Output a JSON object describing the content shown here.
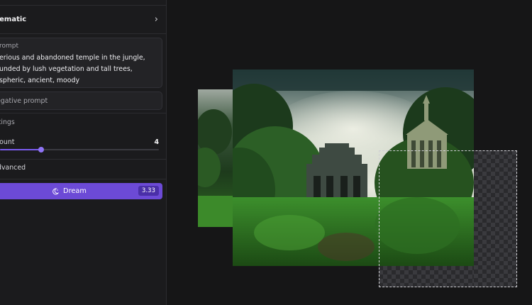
{
  "sidebar": {
    "style": {
      "name": "nematic",
      "chevron_icon": "chevron-right-icon"
    },
    "prompt": {
      "label": "rompt",
      "text": "erious and abandoned temple in the jungle,\nunded by lush vegetation and tall trees,\nspheric, ancient, moody"
    },
    "negative_prompt": {
      "placeholder": "egative prompt",
      "value": ""
    },
    "settings": {
      "title": "ttings",
      "image_count": {
        "label": "count",
        "value": "4",
        "fraction": 0.26
      }
    },
    "advanced": {
      "label": "dvanced"
    },
    "dream": {
      "label": "Dream",
      "cost": "3.33",
      "icon": "moon-sparkle-icon",
      "color": "#6c4ad6"
    }
  },
  "canvas": {
    "accent": "#7b5cf0"
  }
}
